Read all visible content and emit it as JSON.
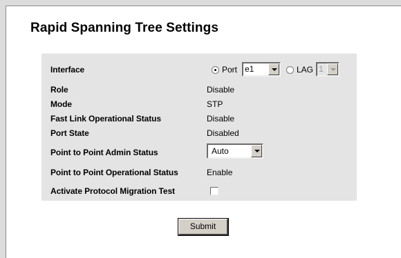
{
  "page": {
    "title": "Rapid Spanning Tree Settings"
  },
  "colors": {
    "page_background": "#dcdcdc",
    "panel_background": "#ffffff",
    "settings_background": "#e4e4e4",
    "button_face": "#d4d0c8"
  },
  "form": {
    "interface": {
      "label": "Interface",
      "port_option_label": "Port",
      "port_selected": true,
      "port_value": "e1",
      "lag_option_label": "LAG",
      "lag_selected": false,
      "lag_value": "1",
      "lag_disabled": true
    },
    "role": {
      "label": "Role",
      "value": "Disable"
    },
    "mode": {
      "label": "Mode",
      "value": "STP"
    },
    "fast_link": {
      "label": "Fast Link Operational Status",
      "value": "Disable"
    },
    "port_state": {
      "label": "Port State",
      "value": "Disabled"
    },
    "p2p_admin": {
      "label": "Point to Point Admin Status",
      "value": "Auto"
    },
    "p2p_oper": {
      "label": "Point to Point Operational Status",
      "value": "Enable"
    },
    "migration_test": {
      "label": "Activate Protocol Migration Test",
      "checked": false
    }
  },
  "actions": {
    "submit_label": "Submit"
  },
  "icons": {
    "dropdown": "chevron-down-icon"
  }
}
